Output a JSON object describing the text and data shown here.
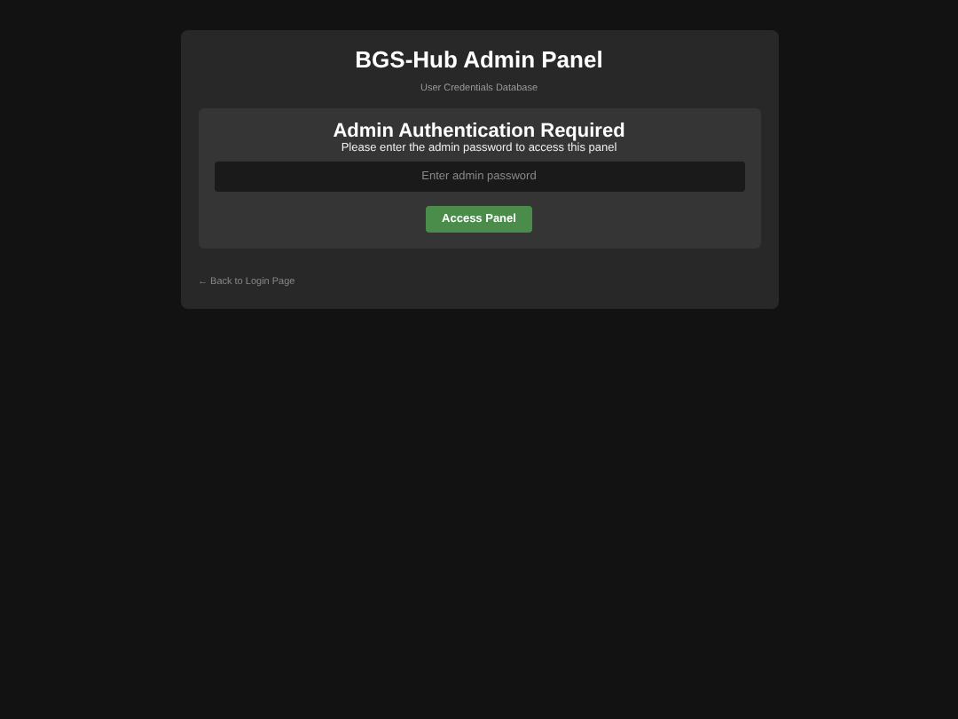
{
  "header": {
    "title": "BGS-Hub Admin Panel",
    "subtitle": "User Credentials Database"
  },
  "auth": {
    "heading": "Admin Authentication Required",
    "message": "Please enter the admin password to access this panel",
    "password": {
      "placeholder": "Enter admin password"
    },
    "button": "Access Panel"
  },
  "back_link": "← Back to Login Page"
}
